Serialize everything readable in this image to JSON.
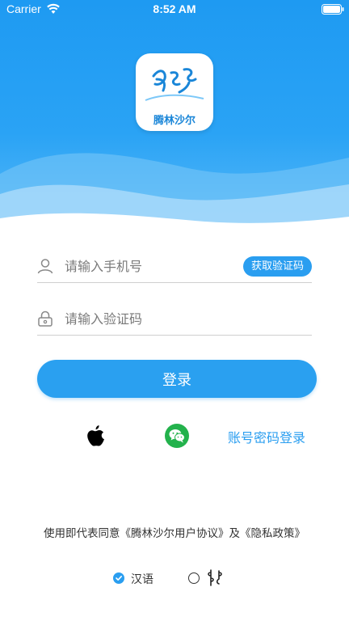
{
  "status_bar": {
    "carrier": "Carrier",
    "time": "8:52 AM"
  },
  "logo": {
    "app_name": "腾林沙尔",
    "brand_color": "#1a86d8"
  },
  "login_form": {
    "phone_placeholder": "请输入手机号",
    "code_placeholder": "请输入验证码",
    "get_code_label": "获取验证码",
    "login_label": "登录"
  },
  "third_party": {
    "apple_icon": "apple-icon",
    "wechat_icon": "wechat-icon",
    "account_login_label": "账号密码登录"
  },
  "agreement_text": "使用即代表同意《腾林沙尔用户协议》及《隐私政策》",
  "language": {
    "options": [
      {
        "label": "汉语",
        "selected": true
      },
      {
        "label": "",
        "selected": false
      }
    ]
  },
  "colors": {
    "accent": "#2a9ef0",
    "wechat": "#23b24c"
  }
}
